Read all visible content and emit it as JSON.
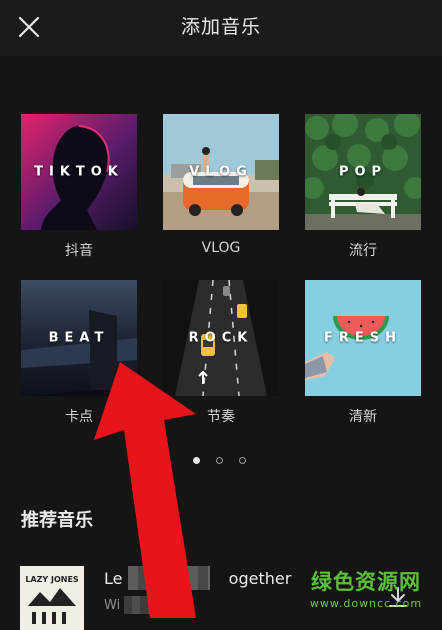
{
  "header": {
    "title": "添加音乐"
  },
  "categories": [
    {
      "cover_text": "TIKTOK",
      "label": "抖音"
    },
    {
      "cover_text": "VLOG",
      "label": "VLOG"
    },
    {
      "cover_text": "POP",
      "label": "流行"
    },
    {
      "cover_text": "BEAT",
      "label": "卡点"
    },
    {
      "cover_text": "ROCK",
      "label": "节奏"
    },
    {
      "cover_text": "FRESH",
      "label": "清新"
    }
  ],
  "pager": {
    "pages": 3,
    "current": 1
  },
  "recommend": {
    "title": "推荐音乐",
    "song": {
      "title_start": "Le",
      "title_end": "ogether",
      "artist_start": "Wi",
      "album_text": "LAZY JONES"
    }
  },
  "watermark": {
    "main": "绿色资源网",
    "sub": "www.downcc.com"
  }
}
